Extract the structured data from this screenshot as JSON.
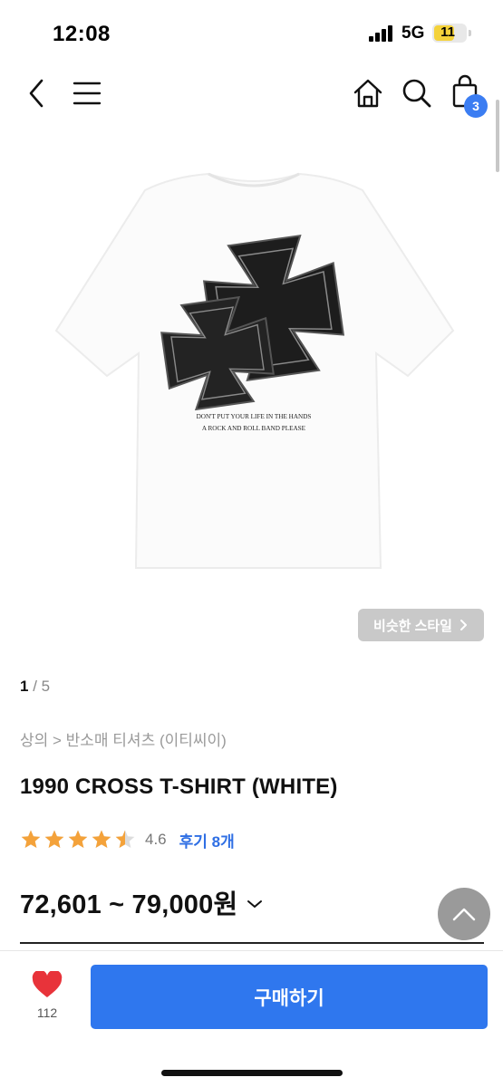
{
  "status_bar": {
    "time": "12:08",
    "network": "5G",
    "battery": "11",
    "battery_fraction": 0.11
  },
  "nav": {
    "icons": [
      "back-icon",
      "menu-icon",
      "home-icon",
      "search-icon",
      "cart-icon"
    ],
    "cart_count": "3"
  },
  "product": {
    "image_text": {
      "line1": "DON'T PUT YOUR LIFE IN THE HANDS",
      "line2": "A ROCK AND ROLL BAND PLEASE"
    },
    "similar_style_label": "비슷한 스타일",
    "pager": {
      "current": "1",
      "separator": " / ",
      "total": "5"
    },
    "breadcrumb": "상의 > 반소매 티셔츠 (이티씨이)",
    "title": "1990 CROSS T-SHIRT (WHITE)",
    "rating": {
      "stars": 4.5,
      "value": "4.6",
      "review_label": "후기 8개"
    },
    "price": "72,601 ~ 79,000원"
  },
  "bottom_bar": {
    "like_count": "112",
    "buy_label": "구매하기"
  },
  "colors": {
    "accent": "#2f77ee",
    "badge": "#3b7df2",
    "star": "#f4a23a",
    "heart": "#e8333a"
  }
}
